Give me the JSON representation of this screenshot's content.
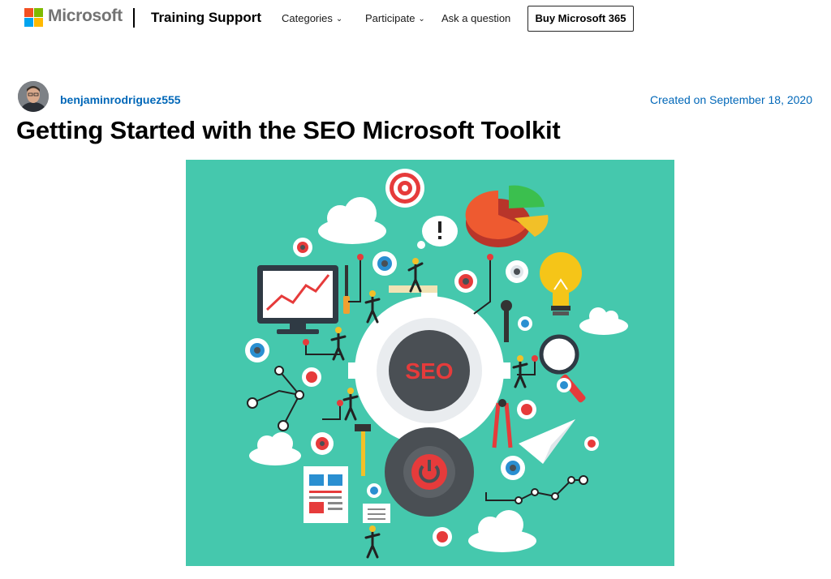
{
  "header": {
    "brand": "Microsoft",
    "site_title": "Training Support",
    "nav": {
      "categories": "Categories",
      "participate": "Participate",
      "ask": "Ask a question"
    },
    "buy_button": "Buy Microsoft 365"
  },
  "post": {
    "author": "benjaminrodriguez555",
    "created": "Created on September 18, 2020",
    "title": "Getting Started with the SEO Microsoft Toolkit",
    "illustration": {
      "center_label": "SEO",
      "background_color": "#45c8ad"
    }
  },
  "colors": {
    "link": "#0067b8",
    "logo_red": "#f25022",
    "logo_green": "#7fba00",
    "logo_blue": "#00a4ef",
    "logo_yellow": "#ffb900"
  }
}
